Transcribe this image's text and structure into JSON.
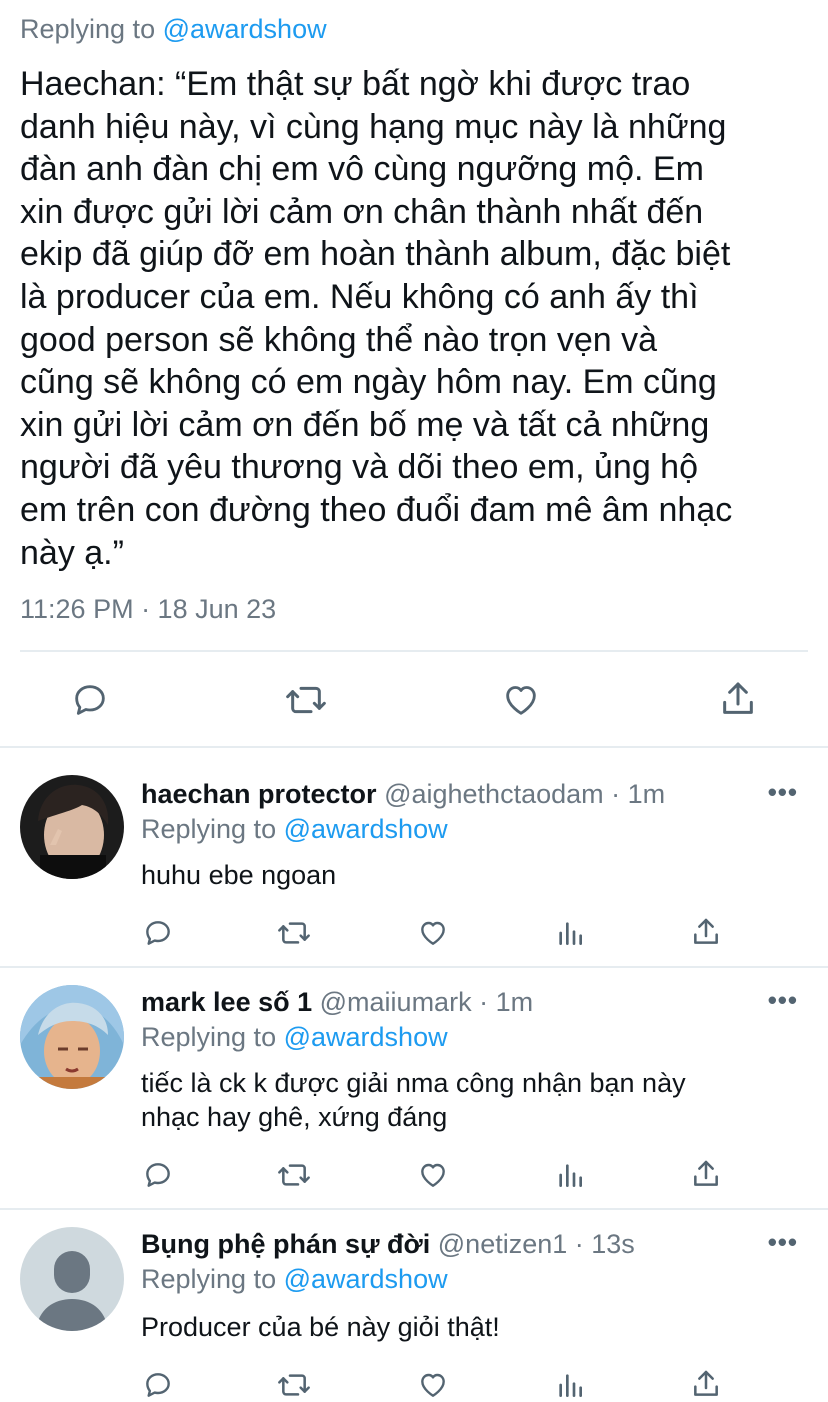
{
  "main_tweet": {
    "replying_prefix": "Replying to",
    "replying_handle": "@awardshow",
    "text": "Haechan: “Em thật sự bất ngờ khi được trao\ndanh hiệu này, vì cùng hạng mục này là những\nđàn anh đàn chị em vô cùng ngưỡng mộ. Em\nxin được gửi lời cảm ơn chân thành nhất đến\nekip đã giúp đỡ em hoàn thành album, đặc biệt\nlà producer của em. Nếu không có anh ấy thì\ngood person sẽ không thể nào trọn vẹn và\ncũng sẽ không có em ngày hôm nay. Em cũng\nxin gửi lời cảm ơn đến bố mẹ và tất cả những\nngười đã yêu thương và dõi theo em, ủng hộ\nem trên con đường theo đuổi đam mê âm nhạc\nnày ạ.”",
    "timestamp": "11:26 PM · 18 Jun 23",
    "actions": [
      "reply-icon",
      "retweet-icon",
      "like-icon",
      "share-icon"
    ]
  },
  "replies": [
    {
      "name": "haechan protector",
      "meta": "@aighethctaodam · 1m",
      "replying_prefix": "Replying to",
      "replying_handle": "@awardshow",
      "text": "huhu ebe ngoan",
      "more": "•••",
      "avatar": "photo-avatar"
    },
    {
      "name": "mark lee số 1",
      "meta": "@maiiumark · 1m",
      "replying_prefix": "Replying to",
      "replying_handle": "@awardshow",
      "text": "tiếc là ck k được giải nma công nhận bạn này nhạc hay ghê, xứng đáng",
      "more": "•••",
      "avatar": "photo-avatar"
    },
    {
      "name": "Bụng phệ phán sự đời",
      "meta": "@netizen1 · 13s",
      "replying_prefix": "Replying to",
      "replying_handle": "@awardshow",
      "text": "Producer của bé này giỏi thật!",
      "more": "•••",
      "avatar": "default-profile-avatar"
    }
  ],
  "colors": {
    "link": "#1d9bf0",
    "secondary_text": "#6b7782",
    "divider": "#e6ecf0",
    "icon": "#536471"
  }
}
